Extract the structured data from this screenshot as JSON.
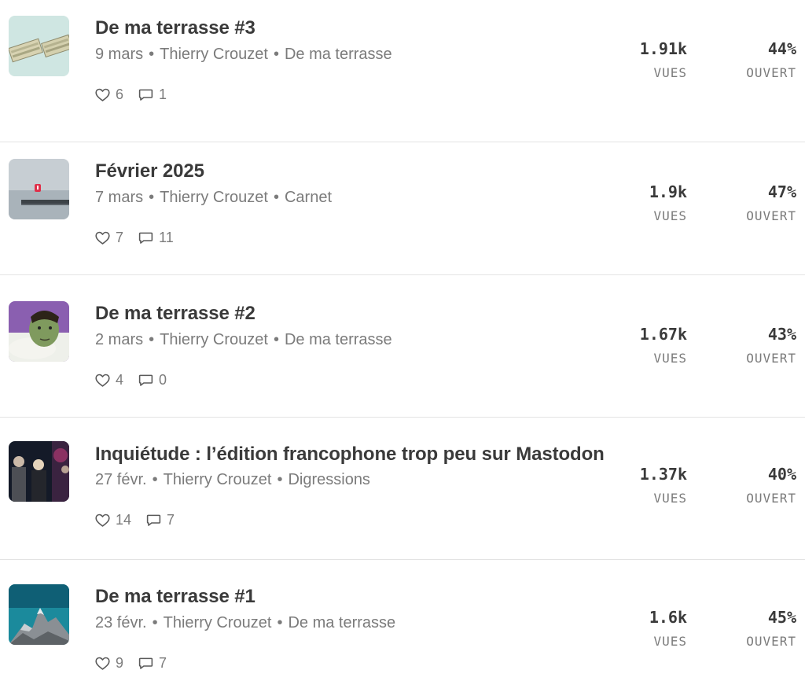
{
  "posts": [
    {
      "title": "De ma terrasse #3",
      "date": "9 mars",
      "author": "Thierry Crouzet",
      "section": "De ma terrasse",
      "likes": "6",
      "comments": "1",
      "views": "1.91k",
      "views_label": "VUES",
      "open_rate": "44%",
      "open_label": "OUVERT",
      "thumbnail": "banknotes-image"
    },
    {
      "title": "Février 2025",
      "date": "7 mars",
      "author": "Thierry Crouzet",
      "section": "Carnet",
      "likes": "7",
      "comments": "11",
      "views": "1.9k",
      "views_label": "VUES",
      "open_rate": "47%",
      "open_label": "OUVERT",
      "thumbnail": "sea-pier-image"
    },
    {
      "title": "De ma terrasse #2",
      "date": "2 mars",
      "author": "Thierry Crouzet",
      "section": "De ma terrasse",
      "likes": "4",
      "comments": "0",
      "views": "1.67k",
      "views_label": "VUES",
      "open_rate": "43%",
      "open_label": "OUVERT",
      "thumbnail": "illustrated-face-image"
    },
    {
      "title": "Inquiétude : l’édition francophone trop peu sur Mastodon",
      "date": "27 févr.",
      "author": "Thierry Crouzet",
      "section": "Digressions",
      "likes": "14",
      "comments": "7",
      "views": "1.37k",
      "views_label": "VUES",
      "open_rate": "40%",
      "open_label": "OUVERT",
      "thumbnail": "stage-people-image"
    },
    {
      "title": "De ma terrasse #1",
      "date": "23 févr.",
      "author": "Thierry Crouzet",
      "section": "De ma terrasse",
      "likes": "9",
      "comments": "7",
      "views": "1.6k",
      "views_label": "VUES",
      "open_rate": "45%",
      "open_label": "OUVERT",
      "thumbnail": "mountain-peak-image"
    }
  ],
  "icons": {
    "like": "heart-icon",
    "comment": "comment-bubble-icon"
  }
}
